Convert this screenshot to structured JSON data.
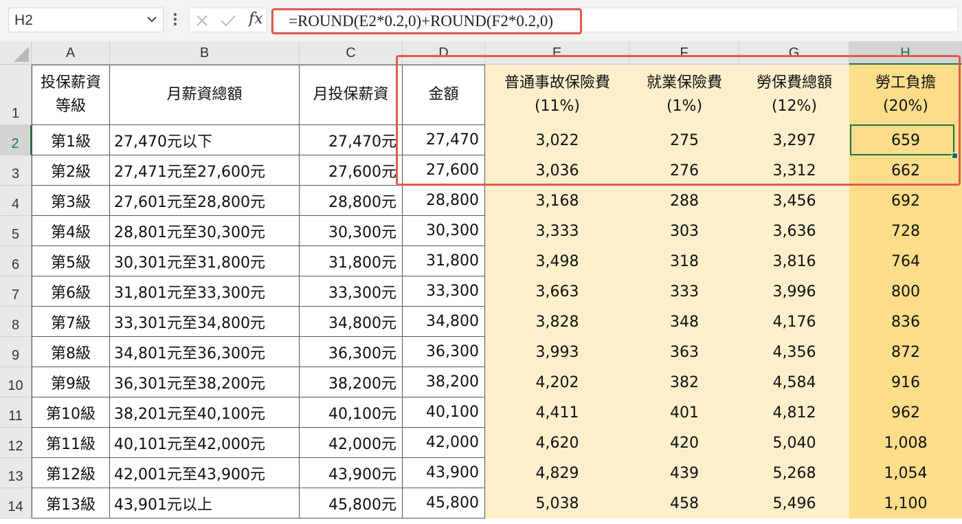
{
  "formula_bar": {
    "name_box": "H2",
    "fx_label": "fx",
    "formula": "=ROUND(E2*0.2,0)+ROUND(F2*0.2,0)"
  },
  "columns": [
    "A",
    "B",
    "C",
    "D",
    "E",
    "F",
    "G",
    "H"
  ],
  "selected_column": "H",
  "selected_row": 2,
  "header_row": {
    "row_num": "1",
    "cells": [
      {
        "line1": "投保薪資",
        "line2": "等級"
      },
      {
        "line1": "月薪資總額",
        "line2": ""
      },
      {
        "line1": "月投保薪資",
        "line2": ""
      },
      {
        "line1": "金額",
        "line2": ""
      },
      {
        "line1": "普通事故保險費",
        "line2": "(11%)"
      },
      {
        "line1": "就業保險費",
        "line2": "(1%)"
      },
      {
        "line1": "勞保費總額",
        "line2": "(12%)"
      },
      {
        "line1": "勞工負擔",
        "line2": "(20%)"
      }
    ]
  },
  "rows": [
    {
      "num": "2",
      "cells": [
        "第1級",
        "27,470元以下",
        "27,470元",
        "27,470",
        "3,022",
        "275",
        "3,297",
        "659"
      ]
    },
    {
      "num": "3",
      "cells": [
        "第2級",
        "27,471元至27,600元",
        "27,600元",
        "27,600",
        "3,036",
        "276",
        "3,312",
        "662"
      ]
    },
    {
      "num": "4",
      "cells": [
        "第3級",
        "27,601元至28,800元",
        "28,800元",
        "28,800",
        "3,168",
        "288",
        "3,456",
        "692"
      ]
    },
    {
      "num": "5",
      "cells": [
        "第4級",
        "28,801元至30,300元",
        "30,300元",
        "30,300",
        "3,333",
        "303",
        "3,636",
        "728"
      ]
    },
    {
      "num": "6",
      "cells": [
        "第5級",
        "30,301元至31,800元",
        "31,800元",
        "31,800",
        "3,498",
        "318",
        "3,816",
        "764"
      ]
    },
    {
      "num": "7",
      "cells": [
        "第6級",
        "31,801元至33,300元",
        "33,300元",
        "33,300",
        "3,663",
        "333",
        "3,996",
        "800"
      ]
    },
    {
      "num": "8",
      "cells": [
        "第7級",
        "33,301元至34,800元",
        "34,800元",
        "34,800",
        "3,828",
        "348",
        "4,176",
        "836"
      ]
    },
    {
      "num": "9",
      "cells": [
        "第8級",
        "34,801元至36,300元",
        "36,300元",
        "36,300",
        "3,993",
        "363",
        "4,356",
        "872"
      ]
    },
    {
      "num": "10",
      "cells": [
        "第9級",
        "36,301元至38,200元",
        "38,200元",
        "38,200",
        "4,202",
        "382",
        "4,584",
        "916"
      ]
    },
    {
      "num": "11",
      "cells": [
        "第10級",
        "38,201元至40,100元",
        "40,100元",
        "40,100",
        "4,411",
        "401",
        "4,812",
        "962"
      ]
    },
    {
      "num": "12",
      "cells": [
        "第11級",
        "40,101元至42,000元",
        "42,000元",
        "42,000",
        "4,620",
        "420",
        "5,040",
        "1,008"
      ]
    },
    {
      "num": "13",
      "cells": [
        "第12級",
        "42,001元至43,900元",
        "43,900元",
        "43,900",
        "4,829",
        "439",
        "5,268",
        "1,054"
      ]
    },
    {
      "num": "14",
      "cells": [
        "第13級",
        "43,901元以上",
        "45,800元",
        "45,800",
        "5,038",
        "458",
        "5,496",
        "1,100"
      ]
    }
  ],
  "colors": {
    "highlight_red": "#e05a50",
    "excel_green": "#217346",
    "light_yellow": "#fdefcc",
    "gold_yellow": "#fbdd8a"
  }
}
